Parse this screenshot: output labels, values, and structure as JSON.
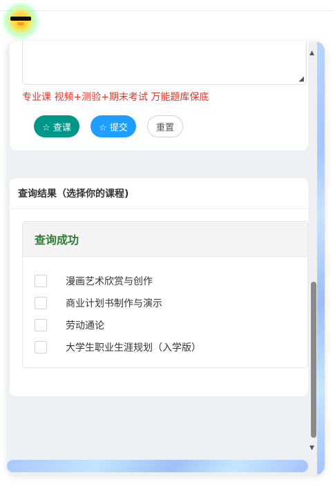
{
  "notice": "专业课 视频+测验+期末考试 万能题库保底",
  "buttons": {
    "search": "☆ 查课",
    "submit": "☆ 提交",
    "reset": "重置"
  },
  "results": {
    "title": "查询结果（选择你的课程)",
    "status": "查询成功",
    "courses": [
      "漫画艺术欣赏与创作",
      "商业计划书制作与演示",
      "劳动通论",
      "大学生职业生涯规划（入学版）"
    ]
  },
  "colors": {
    "search_button": "#009688",
    "submit_button": "#1e9fff",
    "notice": "#d93a2f",
    "status": "#2e7d32"
  },
  "icons": {
    "avatar": "sunglasses-duck-icon",
    "resize": "resize-handle-icon"
  }
}
